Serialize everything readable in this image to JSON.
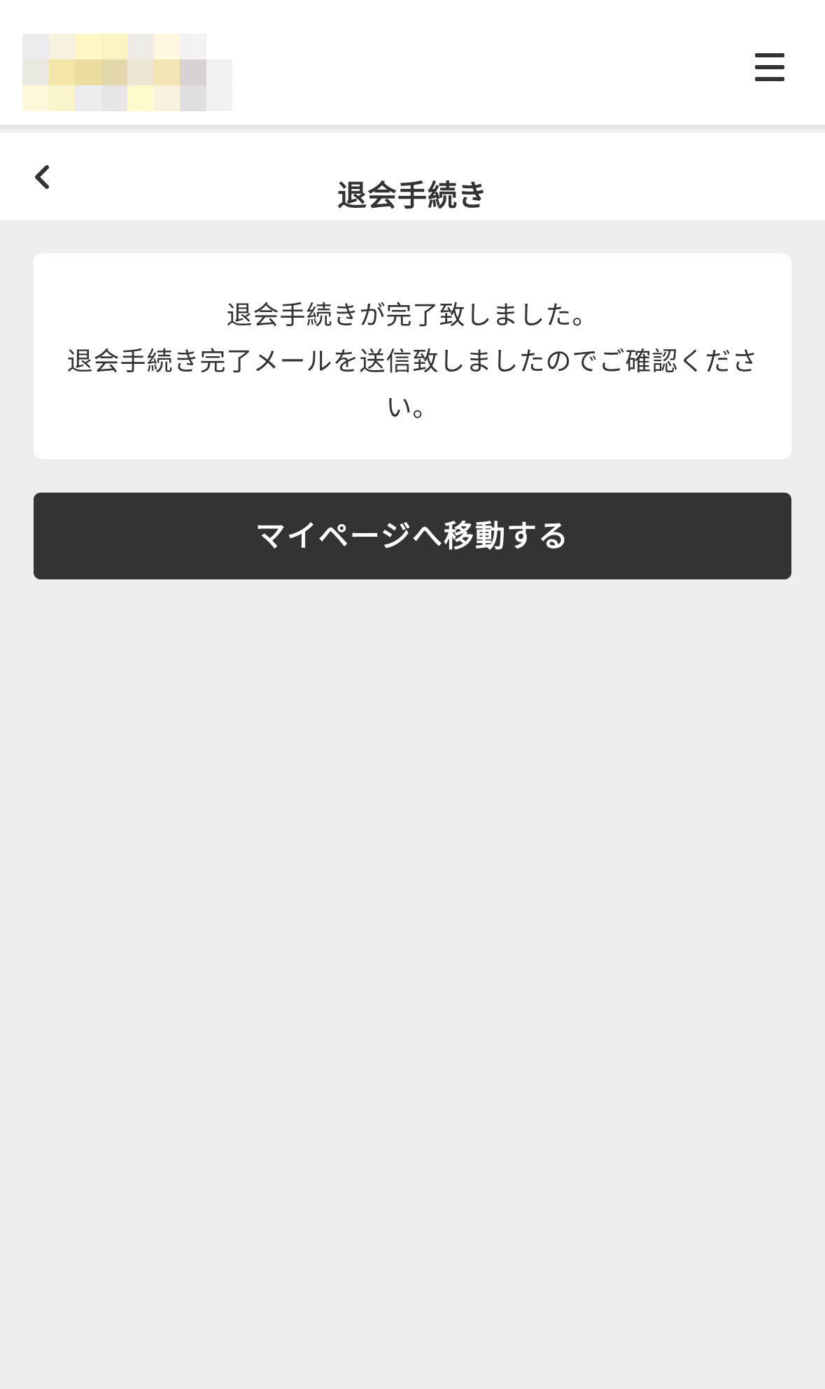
{
  "header": {
    "logo_icon": "pixelated-logo",
    "logo_colors": [
      "#ede9ec",
      "#f6f1df",
      "#fef7c4",
      "#fbf3c2",
      "#eeeae5",
      "#fdf8df",
      "#f4f3f4",
      "#ffffff",
      "#ebe7e1",
      "#f3e6a6",
      "#eadd9f",
      "#e1d7aa",
      "#ebe5d3",
      "#f3e6b3",
      "#d8d2d2",
      "#f2f1f1",
      "#fdf7da",
      "#fbf5cb",
      "#ecebf0",
      "#e8e5e9",
      "#fefacd",
      "#f8f2de",
      "#e1dedf",
      "#f3f2f1"
    ],
    "menu_icon": "hamburger-icon"
  },
  "title_bar": {
    "back_icon": "chevron-left-icon",
    "title": "退会手続き"
  },
  "message": {
    "line1": "退会手続きが完了致しました。",
    "line2": "退会手続き完了メールを送信致しましたのでご確認ください。"
  },
  "actions": {
    "mypage_label": "マイページへ移動する"
  },
  "colors": {
    "background": "#eeeeee",
    "surface": "#ffffff",
    "primary_button": "#333333",
    "text": "#333333"
  }
}
